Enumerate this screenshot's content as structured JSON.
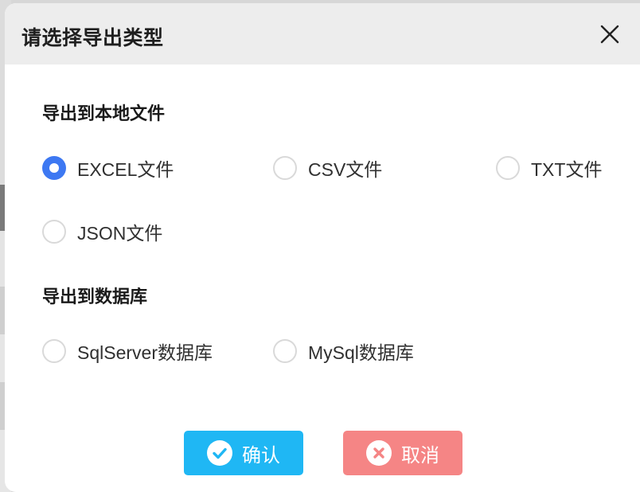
{
  "dialog": {
    "title": "请选择导出类型"
  },
  "sections": {
    "local": {
      "title": "导出到本地文件",
      "options": [
        {
          "label": "EXCEL文件",
          "selected": true
        },
        {
          "label": "CSV文件",
          "selected": false
        },
        {
          "label": "TXT文件",
          "selected": false
        },
        {
          "label": "JSON文件",
          "selected": false
        }
      ]
    },
    "database": {
      "title": "导出到数据库",
      "options": [
        {
          "label": "SqlServer数据库",
          "selected": false
        },
        {
          "label": "MySql数据库",
          "selected": false
        }
      ]
    }
  },
  "buttons": {
    "confirm_label": "确认",
    "cancel_label": "取消"
  },
  "colors": {
    "radio_selected": "#3d78f2",
    "confirm": "#1fb7f4",
    "cancel": "#f58585",
    "header_bg": "#ededed"
  },
  "icons": {
    "close": "close-icon",
    "confirm": "check-circle-icon",
    "cancel": "x-circle-icon"
  }
}
